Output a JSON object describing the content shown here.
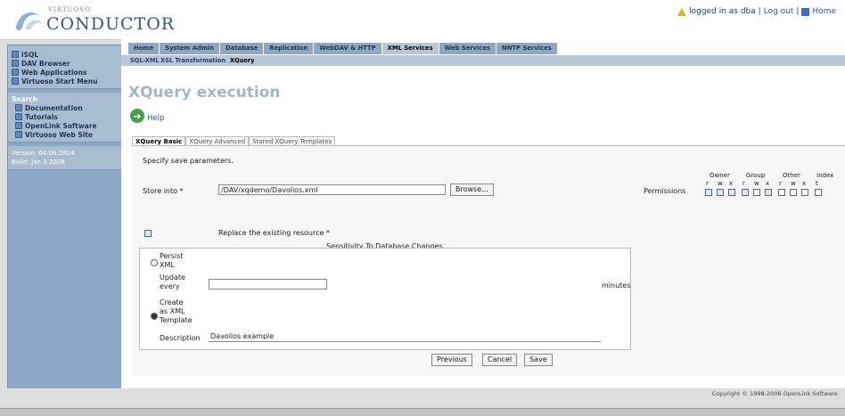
{
  "header": {
    "logo_small": "VIRTUOSO",
    "logo_big": "CONDUCTOR",
    "login_text": "logged in as dba | ",
    "logout_link": "Log out",
    "separator": " | ",
    "home_link": "Home"
  },
  "sidebar": {
    "links": [
      {
        "label": "iSQL",
        "icon": "isql-icon"
      },
      {
        "label": "DAV Browser",
        "icon": "folder-icon"
      },
      {
        "label": "Web Applications",
        "icon": "web-icon"
      },
      {
        "label": "Virtuoso Start Menu",
        "icon": "menu-icon"
      }
    ],
    "search_title": "Search",
    "search_links": [
      {
        "label": "Documentation"
      },
      {
        "label": "Tutorials"
      },
      {
        "label": "OpenLink Software"
      },
      {
        "label": "Virtuoso Web Site"
      }
    ],
    "version": "Version: 04.00.2814",
    "build": "Build: Jan 3 2006"
  },
  "nav": {
    "tabs": [
      "Home",
      "System Admin",
      "Database",
      "Replication",
      "WebDAV & HTTP",
      "XML Services",
      "Web Services",
      "NNTP Services"
    ],
    "active_tab": "XML Services",
    "subtabs": [
      "SQL-XML",
      "XSL Transformation",
      "XQuery"
    ],
    "active_subtab": "XQuery"
  },
  "page": {
    "title": "XQuery execution",
    "help": "Help",
    "form_tabs": [
      "XQuery Basic",
      "XQuery Advanced",
      "Stored XQuery Templates"
    ],
    "active_form_tab": "XQuery Basic"
  },
  "form": {
    "intro": "Specify save parameters.",
    "store_label": "Store into *",
    "store_value": "/DAV/xqdemo/Davolios.xml",
    "browse_label": "Browse...",
    "permissions_label": "Permissions",
    "perm_groups": [
      "Owner",
      "Group",
      "Other",
      "Index"
    ],
    "perm_letters": [
      "r",
      "w",
      "x",
      "r",
      "w",
      "x",
      "r",
      "w",
      "x",
      "t"
    ],
    "perm_checked": [
      true,
      true,
      true,
      true,
      false,
      true,
      false,
      false,
      false,
      false
    ],
    "replace_checked": true,
    "replace_label": "Replace the existing resource *",
    "sensitivity_title": "Sensitivity To Database Changes",
    "persist_label": "Persist XML",
    "update_label": "Update every",
    "update_value": "",
    "minutes_label": "minutes",
    "create_label": "Create as XML Template",
    "selected_option": "create",
    "description_label": "Description",
    "description_value": "Davolios example",
    "buttons": [
      "Previous",
      "Cancel",
      "Save"
    ]
  },
  "footer": {
    "copyright": "Copyright © 1998-2006 OpenLink Software"
  },
  "colors": {
    "sidebar": "#8da8c4",
    "nav_tab": "#8fa7c0",
    "title": "#a8b5c6",
    "link": "#2a55a8"
  }
}
